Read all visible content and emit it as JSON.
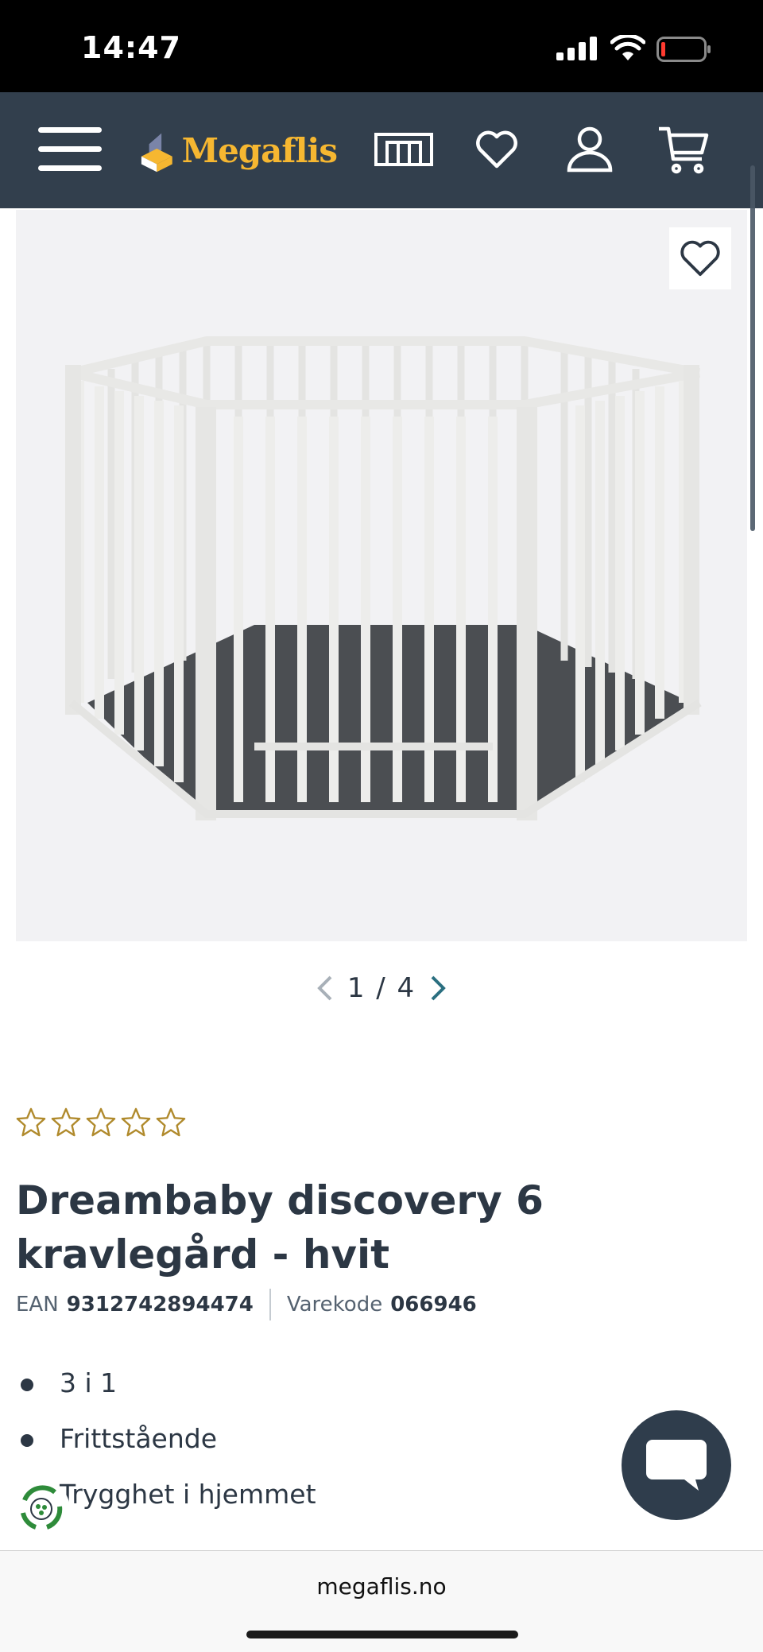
{
  "status_bar": {
    "time": "14:47"
  },
  "header": {
    "logo_text": "Megaflis",
    "brand_color": "#f6b731",
    "background": "#323f4d",
    "icons": [
      "menu-icon",
      "store-icon",
      "heart-icon",
      "user-icon",
      "cart-icon"
    ]
  },
  "gallery": {
    "current": "1",
    "separator": "/",
    "total": "4",
    "pager_label": "1 / 4"
  },
  "product": {
    "rating": 0,
    "rating_max": 5,
    "title": "Dreambaby discovery 6 kravlegård - hvit",
    "ean_label": "EAN",
    "ean_value": "9312742894474",
    "sku_label": "Varekode",
    "sku_value": "066946",
    "bullets": [
      "3 i 1",
      "Frittstående",
      "Trygghet i hjemmet"
    ]
  },
  "browser": {
    "url": "megaflis.no"
  }
}
